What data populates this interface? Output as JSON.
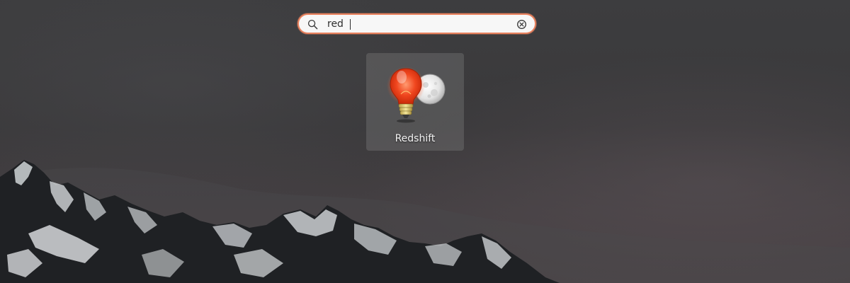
{
  "search": {
    "query": "red",
    "search_icon": "search-icon",
    "clear_icon": "clear-icon"
  },
  "results": [
    {
      "label": "Redshift",
      "icon": "redshift-lightbulb-moon-icon"
    }
  ],
  "colors": {
    "search_focus_border": "#e9825e",
    "search_background": "#f7f7f7",
    "tile_background": "rgba(120,120,120,0.42)",
    "label_text": "#f2f2f2"
  }
}
